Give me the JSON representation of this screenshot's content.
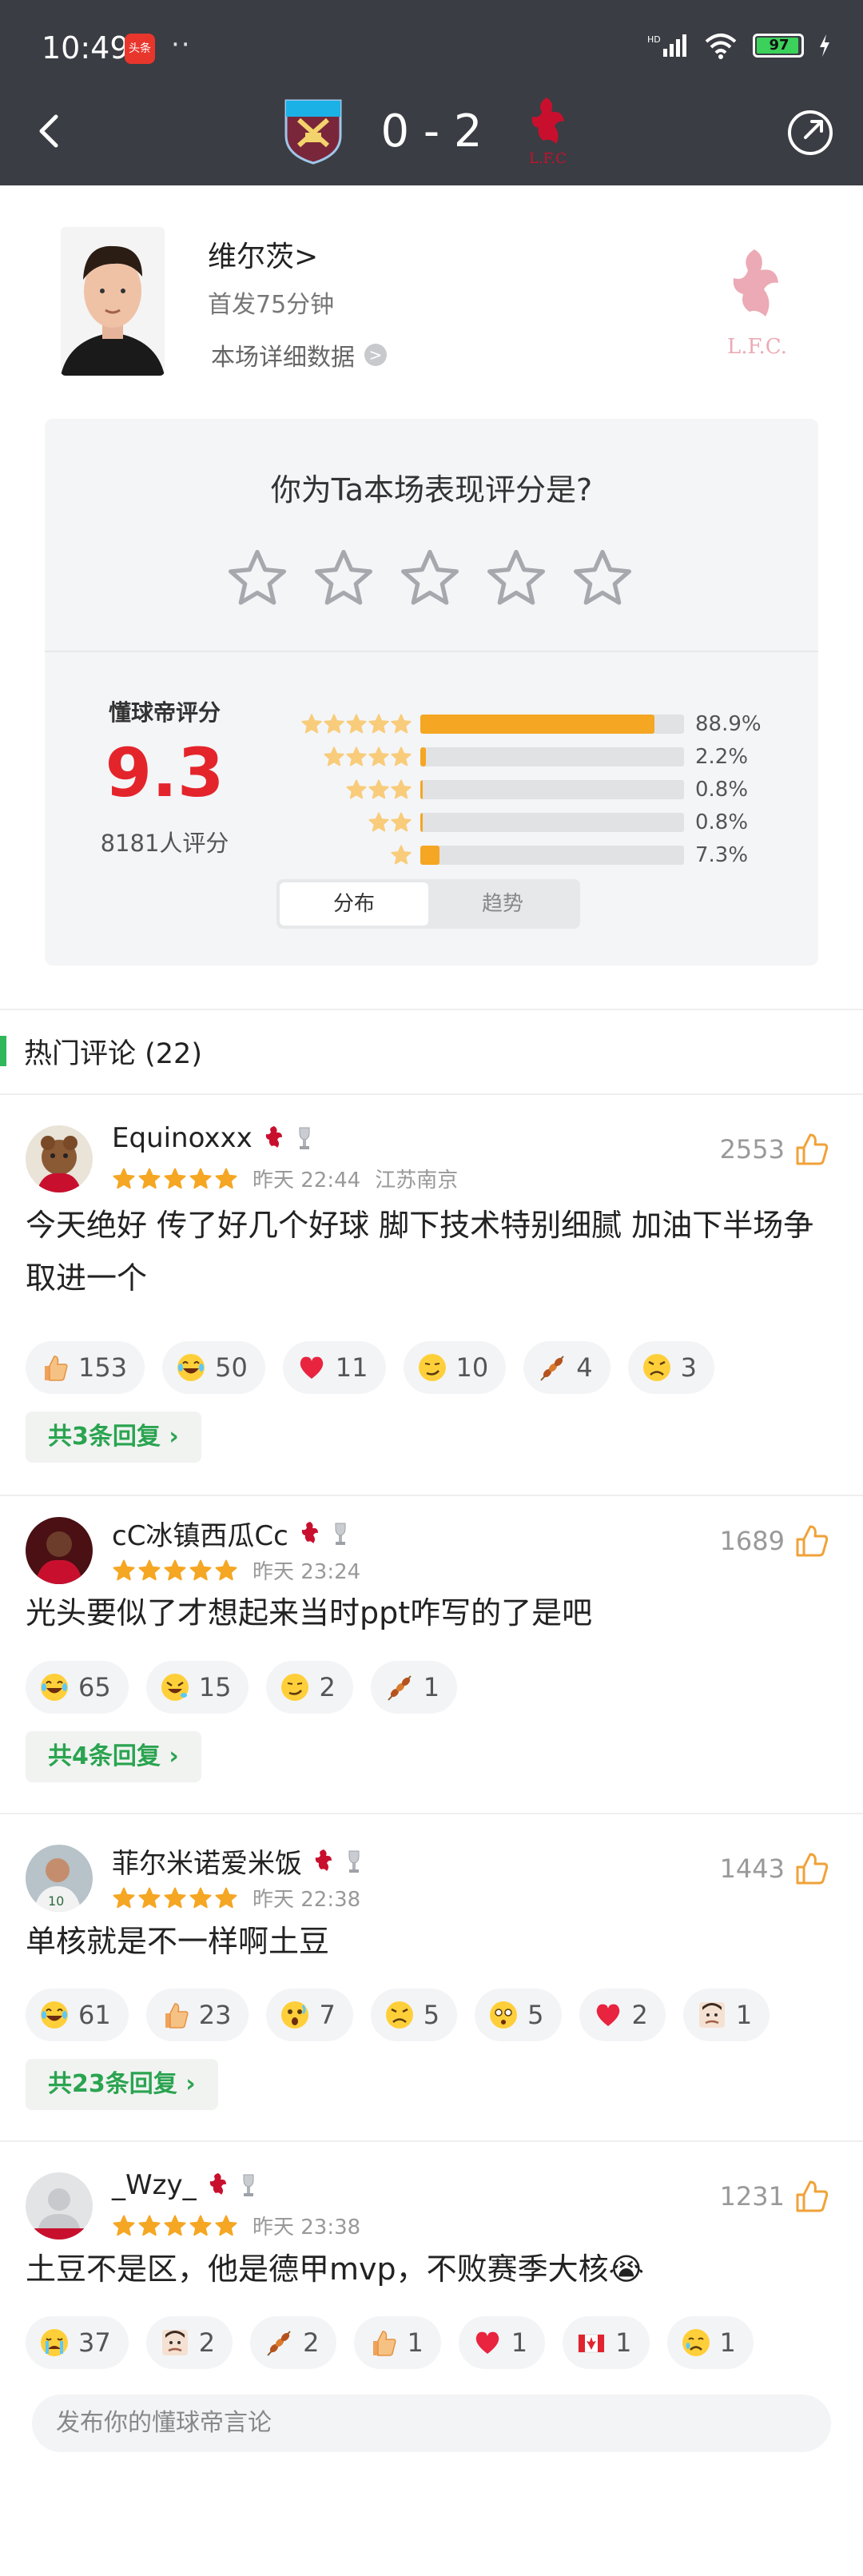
{
  "status_bar": {
    "time": "10:49",
    "app_badge": "头条",
    "battery": "97"
  },
  "match": {
    "score": "0 - 2"
  },
  "player": {
    "name": "维尔茨",
    "chevron": ">",
    "sub": "首发75分钟",
    "link": "本场详细数据",
    "link_arrow": ">"
  },
  "rating_prompt": "你为Ta本场表现评分是?",
  "rating": {
    "title": "懂球帝评分",
    "value": "9.3",
    "count": "8181人评分",
    "distribution": [
      {
        "stars": 5,
        "pct_label": "88.9%",
        "pct": 88.9
      },
      {
        "stars": 4,
        "pct_label": "2.2%",
        "pct": 2.2
      },
      {
        "stars": 3,
        "pct_label": "0.8%",
        "pct": 0.8
      },
      {
        "stars": 2,
        "pct_label": "0.8%",
        "pct": 0.8
      },
      {
        "stars": 1,
        "pct_label": "7.3%",
        "pct": 7.3
      }
    ],
    "tabs": [
      "分布",
      "趋势"
    ]
  },
  "comments_header": "热门评论 (22)",
  "comments": [
    {
      "user": "Equinoxxx",
      "time": "昨天 22:44",
      "location": "江苏南京",
      "likes": "2553",
      "text": "今天绝好 传了好几个好球 脚下技术特别细腻 加油下半场争取进一个",
      "reactions": [
        {
          "icon": "thumbs-up-icon",
          "count": "153"
        },
        {
          "icon": "laughing-face-icon",
          "count": "50"
        },
        {
          "icon": "heart-icon",
          "count": "11"
        },
        {
          "icon": "smirk-face-icon",
          "count": "10"
        },
        {
          "icon": "skewer-icon",
          "count": "4"
        },
        {
          "icon": "frowning-face-icon",
          "count": "3"
        }
      ],
      "replies": "共3条回复"
    },
    {
      "user": "cC冰镇西瓜Cc",
      "time": "昨天 23:24",
      "location": "",
      "likes": "1689",
      "text": "光头要似了才想起来当时ppt咋写的了是吧",
      "reactions": [
        {
          "icon": "laughing-face-icon",
          "count": "65"
        },
        {
          "icon": "rolling-laugh-icon",
          "count": "15"
        },
        {
          "icon": "smirk-face-icon",
          "count": "2"
        },
        {
          "icon": "skewer-icon",
          "count": "1"
        }
      ],
      "replies": "共4条回复"
    },
    {
      "user": "菲尔米诺爱米饭",
      "time": "昨天 22:38",
      "location": "",
      "likes": "1443",
      "text": "单核就是不一样啊土豆",
      "reactions": [
        {
          "icon": "laughing-face-icon",
          "count": "61"
        },
        {
          "icon": "thumbs-up-icon",
          "count": "23"
        },
        {
          "icon": "shocked-face-icon",
          "count": "7"
        },
        {
          "icon": "frowning-face-icon",
          "count": "5"
        },
        {
          "icon": "surprised-face-icon",
          "count": "5"
        },
        {
          "icon": "heart-icon",
          "count": "2"
        },
        {
          "icon": "person-face-icon",
          "count": "1"
        }
      ],
      "replies": "共23条回复"
    },
    {
      "user": "_Wzy_",
      "time": "昨天 23:38",
      "location": "",
      "likes": "1231",
      "text": "土豆不是区，他是德甲mvp，不败赛季大核😭",
      "reactions": [
        {
          "icon": "crying-face-icon",
          "count": "37"
        },
        {
          "icon": "person-face-icon",
          "count": "2"
        },
        {
          "icon": "skewer-icon",
          "count": "2"
        },
        {
          "icon": "thumbs-up-icon",
          "count": "1"
        },
        {
          "icon": "heart-icon",
          "count": "1"
        },
        {
          "icon": "canada-flag-icon",
          "count": "1"
        },
        {
          "icon": "sad-face-icon",
          "count": "1"
        }
      ],
      "replies": ""
    }
  ],
  "compose_placeholder": "发布你的懂球帝言论",
  "colors": {
    "header_bg": "#3a3d43",
    "accent_green": "#2fb75a",
    "star_orange": "#f5a623",
    "score_red": "#e4242b"
  }
}
